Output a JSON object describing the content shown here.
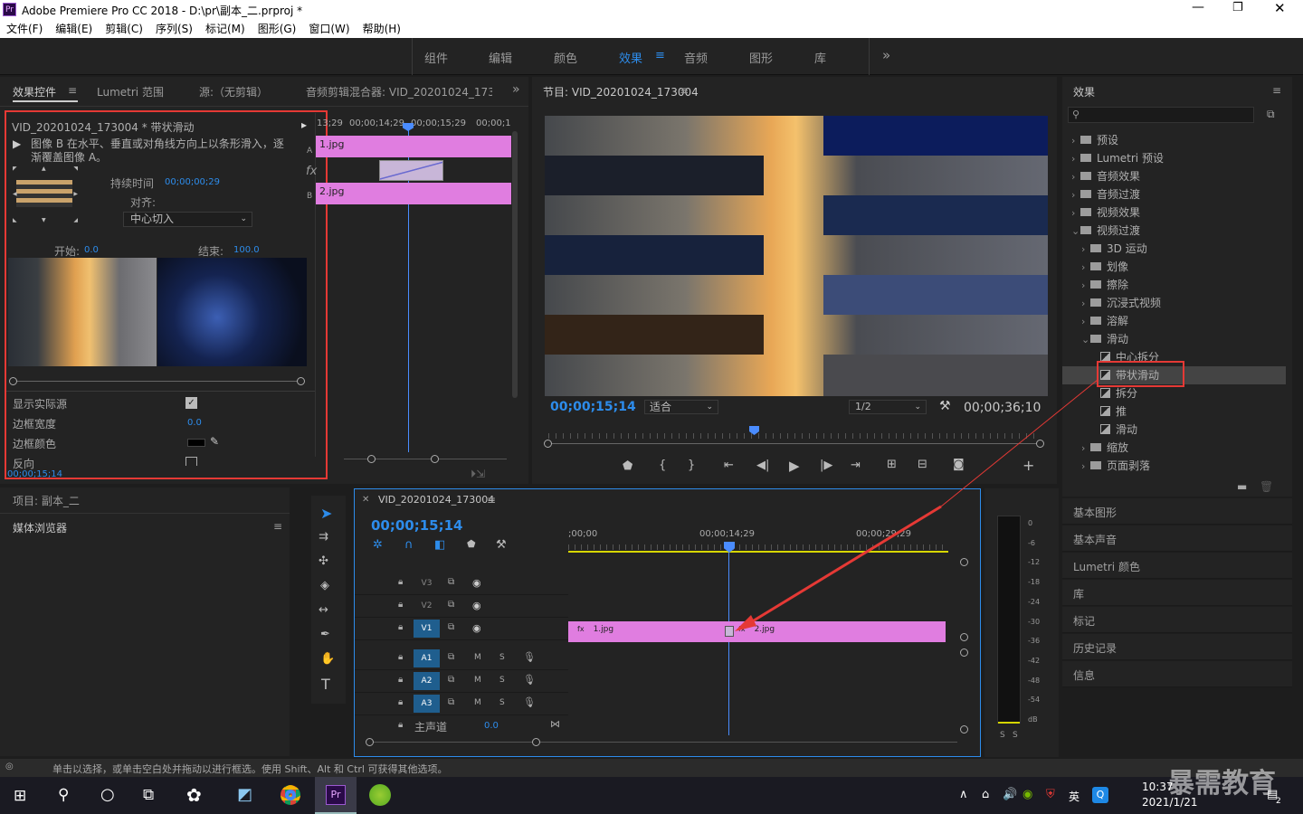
{
  "window": {
    "title": "Adobe Premiere Pro CC 2018 - D:\\pr\\副本_二.prproj *",
    "app_icon": "Pr"
  },
  "menu": [
    "文件(F)",
    "编辑(E)",
    "剪辑(C)",
    "序列(S)",
    "标记(M)",
    "图形(G)",
    "窗口(W)",
    "帮助(H)"
  ],
  "workspaces": [
    "组件",
    "编辑",
    "颜色",
    "效果",
    "音频",
    "图形",
    "库"
  ],
  "active_workspace": "效果",
  "effect_controls": {
    "tabs": [
      "效果控件",
      "Lumetri 范围",
      "源:（无剪辑）",
      "音频剪辑混合器: VID_20201024_173004"
    ],
    "clip_label": "VID_20201024_173004 * 带状滑动",
    "description": "图像 B 在水平、垂直或对角线方向上以条形滑入，逐渐覆盖图像 A。",
    "duration_label": "持续时间",
    "duration_value": "00;00;00;29",
    "align_label": "对齐:",
    "align_value": "中心切入",
    "start_label": "开始:",
    "start_value": "0.0",
    "end_label": "结束:",
    "end_value": "100.0",
    "show_source_label": "显示实际源",
    "border_width_label": "边框宽度",
    "border_width_value": "0.0",
    "border_color_label": "边框颜色",
    "reverse_label": "反向",
    "timecode": "00;00;15;14",
    "mini_ruler": [
      "13;29",
      "00;00;14;29",
      "00;00;15;29",
      "00;00;1"
    ],
    "clip_a": "1.jpg",
    "clip_b": "2.jpg",
    "track_a": "A",
    "track_b": "B",
    "fx": "fx"
  },
  "program": {
    "title": "节目: VID_20201024_173004",
    "timecode": "00;00;15;14",
    "fit": "适合",
    "resolution": "1/2",
    "duration": "00;00;36;10"
  },
  "effects_panel": {
    "title": "效果",
    "items": [
      {
        "label": "预设",
        "level": 0,
        "kind": "bin",
        "open": false
      },
      {
        "label": "Lumetri 预设",
        "level": 0,
        "kind": "bin",
        "open": false
      },
      {
        "label": "音频效果",
        "level": 0,
        "kind": "folder",
        "open": false
      },
      {
        "label": "音频过渡",
        "level": 0,
        "kind": "folder",
        "open": false
      },
      {
        "label": "视频效果",
        "level": 0,
        "kind": "folder",
        "open": false
      },
      {
        "label": "视频过渡",
        "level": 0,
        "kind": "folder",
        "open": true
      },
      {
        "label": "3D 运动",
        "level": 1,
        "kind": "folder",
        "open": false
      },
      {
        "label": "划像",
        "level": 1,
        "kind": "folder",
        "open": false
      },
      {
        "label": "擦除",
        "level": 1,
        "kind": "folder",
        "open": false
      },
      {
        "label": "沉浸式视频",
        "level": 1,
        "kind": "folder",
        "open": false
      },
      {
        "label": "溶解",
        "level": 1,
        "kind": "folder",
        "open": false
      },
      {
        "label": "滑动",
        "level": 1,
        "kind": "folder",
        "open": true
      },
      {
        "label": "中心拆分",
        "level": 2,
        "kind": "fx"
      },
      {
        "label": "带状滑动",
        "level": 2,
        "kind": "fx",
        "selected": true
      },
      {
        "label": "拆分",
        "level": 2,
        "kind": "fx"
      },
      {
        "label": "推",
        "level": 2,
        "kind": "fx"
      },
      {
        "label": "滑动",
        "level": 2,
        "kind": "fx"
      },
      {
        "label": "缩放",
        "level": 1,
        "kind": "folder",
        "open": false
      },
      {
        "label": "页面剥落",
        "level": 1,
        "kind": "folder",
        "open": false
      }
    ]
  },
  "right_panels": [
    "基本图形",
    "基本声音",
    "Lumetri 颜色",
    "库",
    "标记",
    "历史记录",
    "信息"
  ],
  "project": {
    "title": "项目: 副本_二",
    "media_browser": "媒体浏览器"
  },
  "timeline": {
    "title": "VID_20201024_173004",
    "timecode": "00;00;15;14",
    "ruler": [
      ";00;00",
      "00;00;14;29",
      "00;00;29;29"
    ],
    "video_tracks": [
      "V3",
      "V2",
      "V1"
    ],
    "audio_tracks": [
      "A1",
      "A2",
      "A3"
    ],
    "master_label": "主声道",
    "master_value": "0.0",
    "clip1": "1.jpg",
    "clip2": "2.jpg",
    "m": "M",
    "s": "S"
  },
  "meter": {
    "scale": [
      "0",
      "-6",
      "-12",
      "-18",
      "-24",
      "-30",
      "-36",
      "-42",
      "-48",
      "-54",
      "dB"
    ],
    "solo": [
      "S",
      "S"
    ]
  },
  "status": "单击以选择，或单击空白处并拖动以进行框选。使用 Shift、Alt 和 Ctrl 可获得其他选项。",
  "taskbar": {
    "time": "10:37",
    "date": "2021/1/21",
    "ime": "英",
    "notify": "2",
    "watermark": "暴需教育"
  },
  "colors": {
    "accent": "#2d8ceb",
    "clip_pink": "#e07de0",
    "highlight_red": "#e53935",
    "panel": "#232323"
  }
}
